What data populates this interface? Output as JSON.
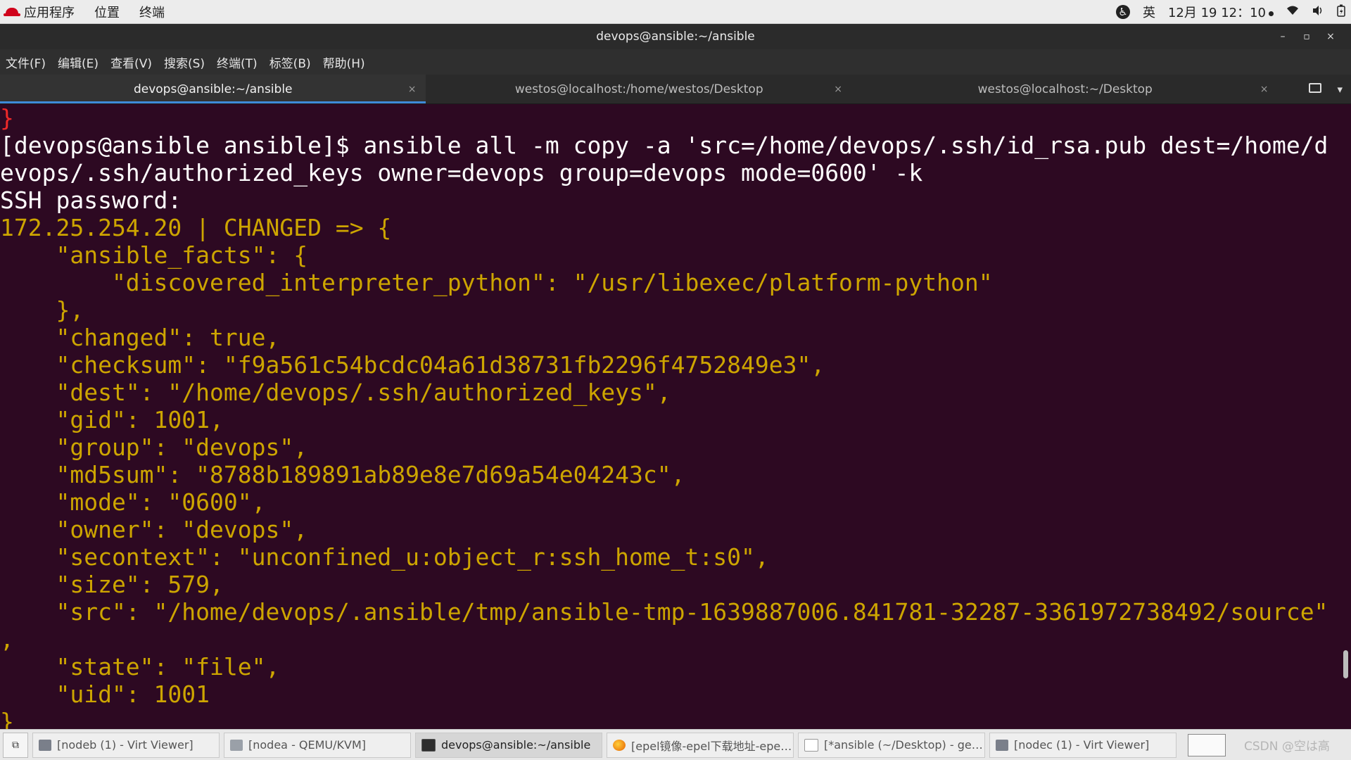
{
  "topbar": {
    "applications": "应用程序",
    "places": "位置",
    "terminal": "终端",
    "input_method": "英",
    "clock": "12月 19 12：10"
  },
  "window": {
    "title": "devops@ansible:~/ansible",
    "minimize": "–",
    "maximize": "▫",
    "close": "×"
  },
  "menubar": {
    "items": [
      "文件(F)",
      "编辑(E)",
      "查看(V)",
      "搜索(S)",
      "终端(T)",
      "标签(B)",
      "帮助(H)"
    ]
  },
  "tabs": [
    {
      "label": "devops@ansible:~/ansible",
      "active": true,
      "close": "×"
    },
    {
      "label": "westos@localhost:/home/westos/Desktop",
      "active": false,
      "close": "×"
    },
    {
      "label": "westos@localhost:~/Desktop",
      "active": false,
      "close": "×"
    }
  ],
  "terminal": {
    "lines": [
      {
        "text": "}",
        "color": "red"
      },
      {
        "text": "[devops@ansible ansible]$ ansible all -m copy -a 'src=/home/devops/.ssh/id_rsa.pub dest=/home/d",
        "color": "white"
      },
      {
        "text": "evops/.ssh/authorized_keys owner=devops group=devops mode=0600' -k",
        "color": "white"
      },
      {
        "text": "SSH password:",
        "color": "white"
      },
      {
        "text": "172.25.254.20 | CHANGED => {",
        "color": "yellow"
      },
      {
        "text": "    \"ansible_facts\": {",
        "color": "yellow"
      },
      {
        "text": "        \"discovered_interpreter_python\": \"/usr/libexec/platform-python\"",
        "color": "yellow"
      },
      {
        "text": "    },",
        "color": "yellow"
      },
      {
        "text": "    \"changed\": true,",
        "color": "yellow"
      },
      {
        "text": "    \"checksum\": \"f9a561c54bcdc04a61d38731fb2296f4752849e3\",",
        "color": "yellow"
      },
      {
        "text": "    \"dest\": \"/home/devops/.ssh/authorized_keys\",",
        "color": "yellow"
      },
      {
        "text": "    \"gid\": 1001,",
        "color": "yellow"
      },
      {
        "text": "    \"group\": \"devops\",",
        "color": "yellow"
      },
      {
        "text": "    \"md5sum\": \"8788b189891ab89e8e7d69a54e04243c\",",
        "color": "yellow"
      },
      {
        "text": "    \"mode\": \"0600\",",
        "color": "yellow"
      },
      {
        "text": "    \"owner\": \"devops\",",
        "color": "yellow"
      },
      {
        "text": "    \"secontext\": \"unconfined_u:object_r:ssh_home_t:s0\",",
        "color": "yellow"
      },
      {
        "text": "    \"size\": 579,",
        "color": "yellow"
      },
      {
        "text": "    \"src\": \"/home/devops/.ansible/tmp/ansible-tmp-1639887006.841781-32287-3361972738492/source\"",
        "color": "yellow"
      },
      {
        "text": ",",
        "color": "yellow"
      },
      {
        "text": "    \"state\": \"file\",",
        "color": "yellow"
      },
      {
        "text": "    \"uid\": 1001",
        "color": "yellow"
      },
      {
        "text": "}",
        "color": "yellow"
      }
    ]
  },
  "taskbar": {
    "items": [
      {
        "label": "[nodeb (1) - Virt Viewer]",
        "icon": "monitor-icon",
        "active": false
      },
      {
        "label": "[nodea - QEMU/KVM]",
        "icon": "qemu-icon",
        "active": false
      },
      {
        "label": "devops@ansible:~/ansible",
        "icon": "terminal-icon",
        "active": true
      },
      {
        "label": "[epel镜像-epel下载地址-epe…",
        "icon": "firefox-icon",
        "active": false
      },
      {
        "label": "[*ansible (~/Desktop) - gedit]",
        "icon": "gedit-icon",
        "active": false
      },
      {
        "label": "[nodec (1) - Virt Viewer]",
        "icon": "monitor-icon",
        "active": false
      }
    ],
    "watermark": "CSDN @空は高"
  },
  "colors": {
    "terminal_bg": "#2d0922",
    "terminal_yellow": "#cda500",
    "terminal_red": "#ef2929",
    "tab_accent": "#3f8bd9"
  }
}
